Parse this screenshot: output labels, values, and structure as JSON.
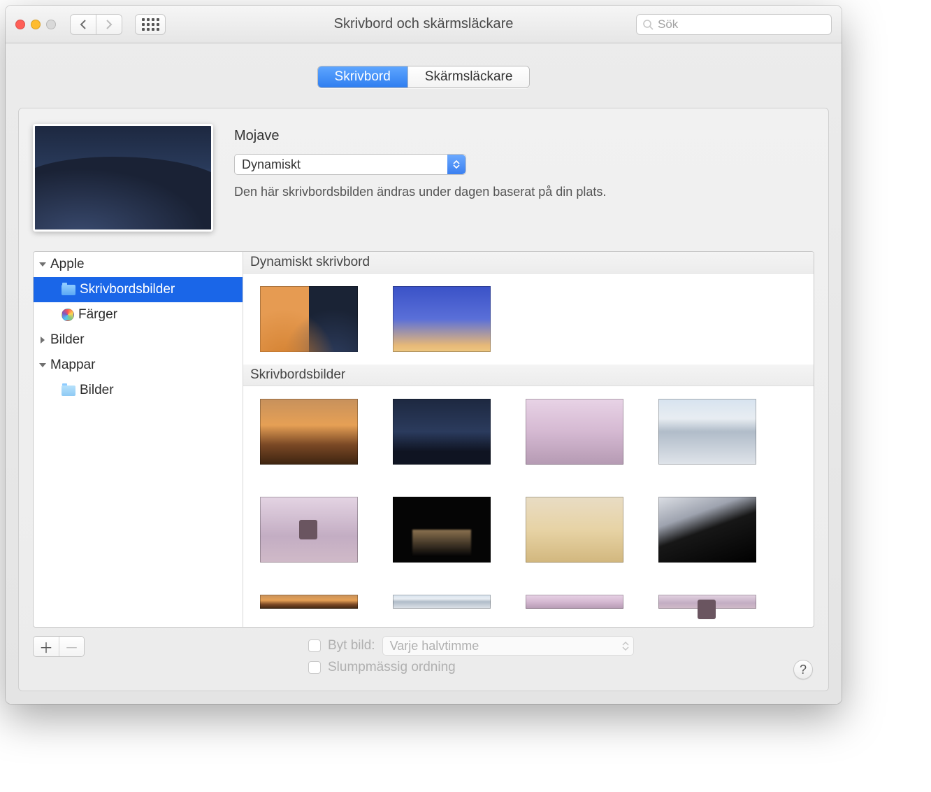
{
  "window": {
    "title": "Skrivbord och skärmsläckare",
    "search_placeholder": "Sök"
  },
  "tabs": {
    "desktop": "Skrivbord",
    "screensaver": "Skärmsläckare"
  },
  "preview": {
    "name": "Mojave",
    "mode_selected": "Dynamiskt",
    "description": "Den här skrivbordsbilden ändras under dagen baserat på din plats."
  },
  "sidebar": {
    "apple": "Apple",
    "desktop_pictures": "Skrivbordsbilder",
    "colors": "Färger",
    "pictures": "Bilder",
    "folders": "Mappar",
    "folder_pictures": "Bilder"
  },
  "gallery": {
    "section_dynamic": "Dynamiskt skrivbord",
    "section_pictures": "Skrivbordsbilder"
  },
  "bottom": {
    "change_picture": "Byt bild:",
    "interval_selected": "Varje halvtimme",
    "random_order": "Slumpmässig ordning",
    "help": "?"
  }
}
